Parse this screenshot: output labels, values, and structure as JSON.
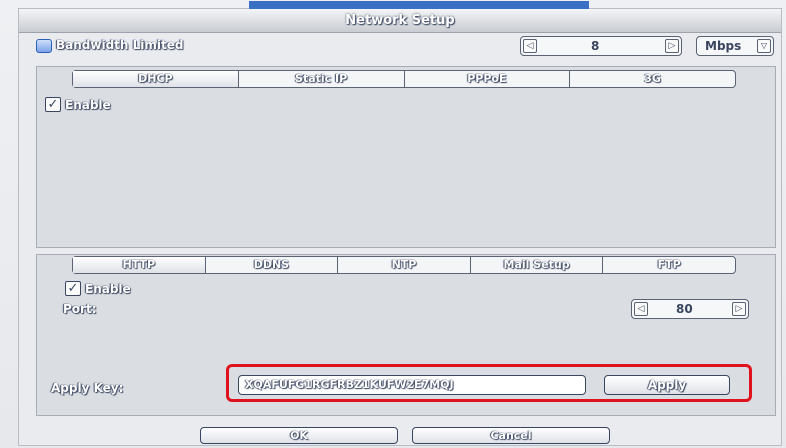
{
  "window": {
    "title": "Network Setup"
  },
  "bandwidth": {
    "label": "Bandwidth Limited",
    "checked": true,
    "value": "8",
    "unit": "Mbps",
    "dec_glyph": "◁",
    "inc_glyph": "▷",
    "dropdown_glyph": "▽"
  },
  "connection_tabs": [
    {
      "label": "DHCP",
      "active": true
    },
    {
      "label": "Static IP",
      "active": false
    },
    {
      "label": "PPPoE",
      "active": false
    },
    {
      "label": "3G",
      "active": false
    }
  ],
  "connection_panel": {
    "enable_label": "Enable",
    "enable_checked": true
  },
  "service_tabs": [
    {
      "label": "HTTP",
      "active": true
    },
    {
      "label": "DDNS",
      "active": false
    },
    {
      "label": "NTP",
      "active": false
    },
    {
      "label": "Mail Setup",
      "active": false
    },
    {
      "label": "FTP",
      "active": false
    }
  ],
  "service_panel": {
    "enable_label": "Enable",
    "enable_checked": true,
    "port_label": "Port:",
    "port_value": "80",
    "apply_key_label": "Apply Key:",
    "apply_key_value": "XQAFUFG1RGFRBZ1KUFW2E7MQJ",
    "apply_label": "Apply"
  },
  "footer": {
    "ok_label": "OK",
    "cancel_label": "Cancel"
  },
  "colors": {
    "highlight_border": "#e0121d",
    "title_accent": "#3b6fc4",
    "checkbox_blue": "#7aa3e8"
  },
  "icons": {
    "check_glyph": "✓"
  }
}
